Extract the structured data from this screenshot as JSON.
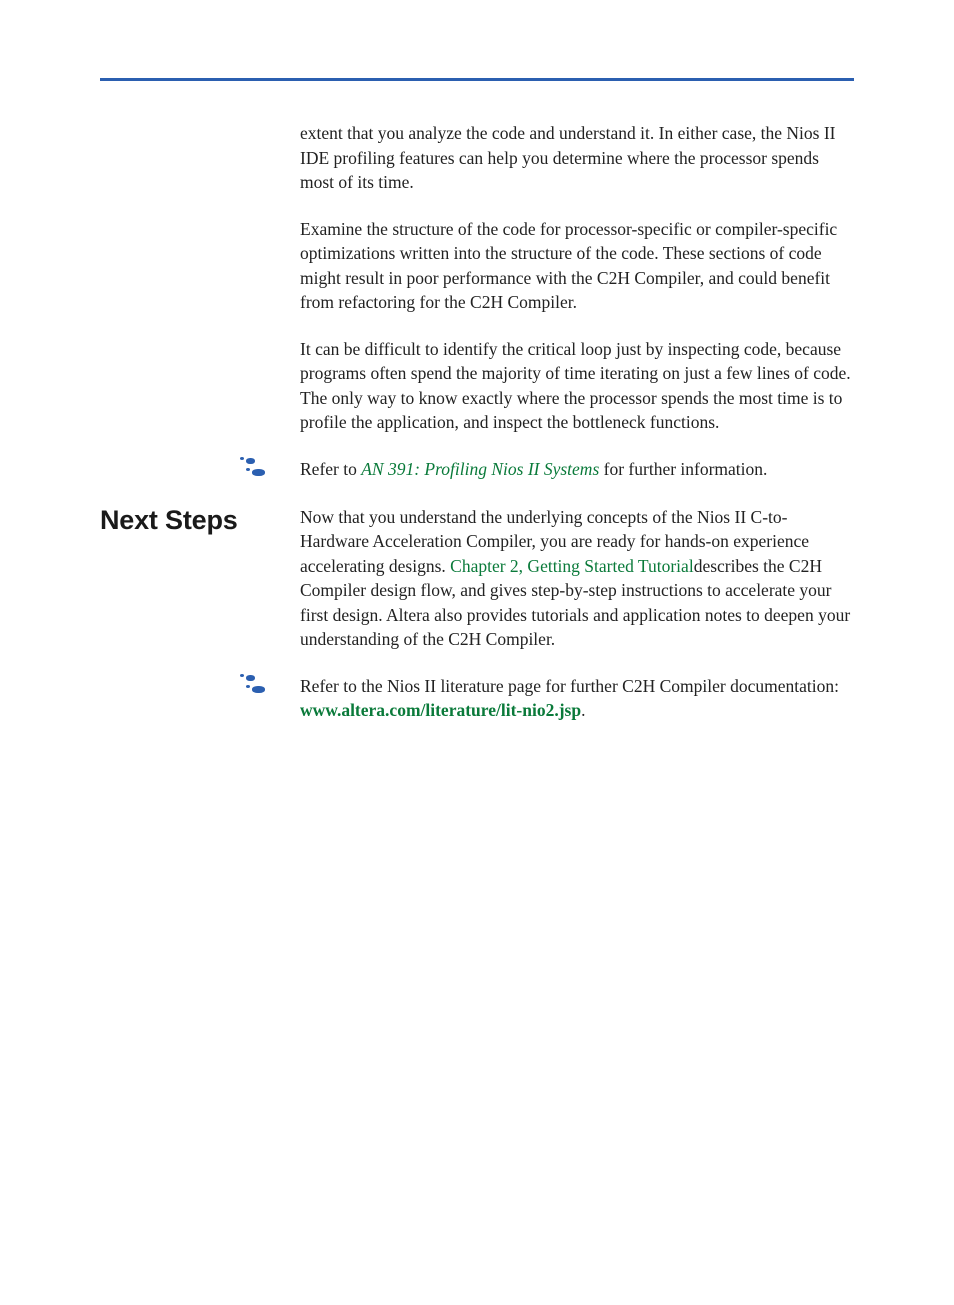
{
  "body": {
    "para1": "extent that you analyze the code and understand it. In either case, the Nios II IDE profiling features can help you determine where the processor spends most of its time.",
    "para2": "Examine the structure of the code for processor-specific or compiler-specific optimizations written into the structure of the code. These sections of code might result in poor performance with the C2H Compiler, and could benefit from refactoring for the C2H Compiler.",
    "para3": "It can be difficult to identify the critical loop just by inspecting code, because programs often spend the majority of time iterating on just a few lines of code. The only way to know exactly where the processor spends the most time is to profile the application, and inspect the bottleneck functions."
  },
  "note1": {
    "prefix": "Refer to ",
    "link": "AN 391: Profiling Nios II Systems",
    "suffix": " for further information."
  },
  "heading": "Next Steps",
  "next_steps": {
    "prefix": "Now that you understand the underlying concepts of the Nios II C-to-Hardware Acceleration Compiler, you are ready for hands-on experience accelerating designs. ",
    "link": "Chapter 2, Getting Started Tutorial",
    "suffix": "describes the C2H Compiler design flow, and gives step-by-step instructions to accelerate your first design. Altera also provides tutorials and application notes to deepen your understanding of the C2H Compiler."
  },
  "note2": {
    "prefix": "Refer to the Nios II literature page for further C2H Compiler documentation: ",
    "link": "www.altera.com/literature/lit-nio2.jsp",
    "suffix": "."
  }
}
